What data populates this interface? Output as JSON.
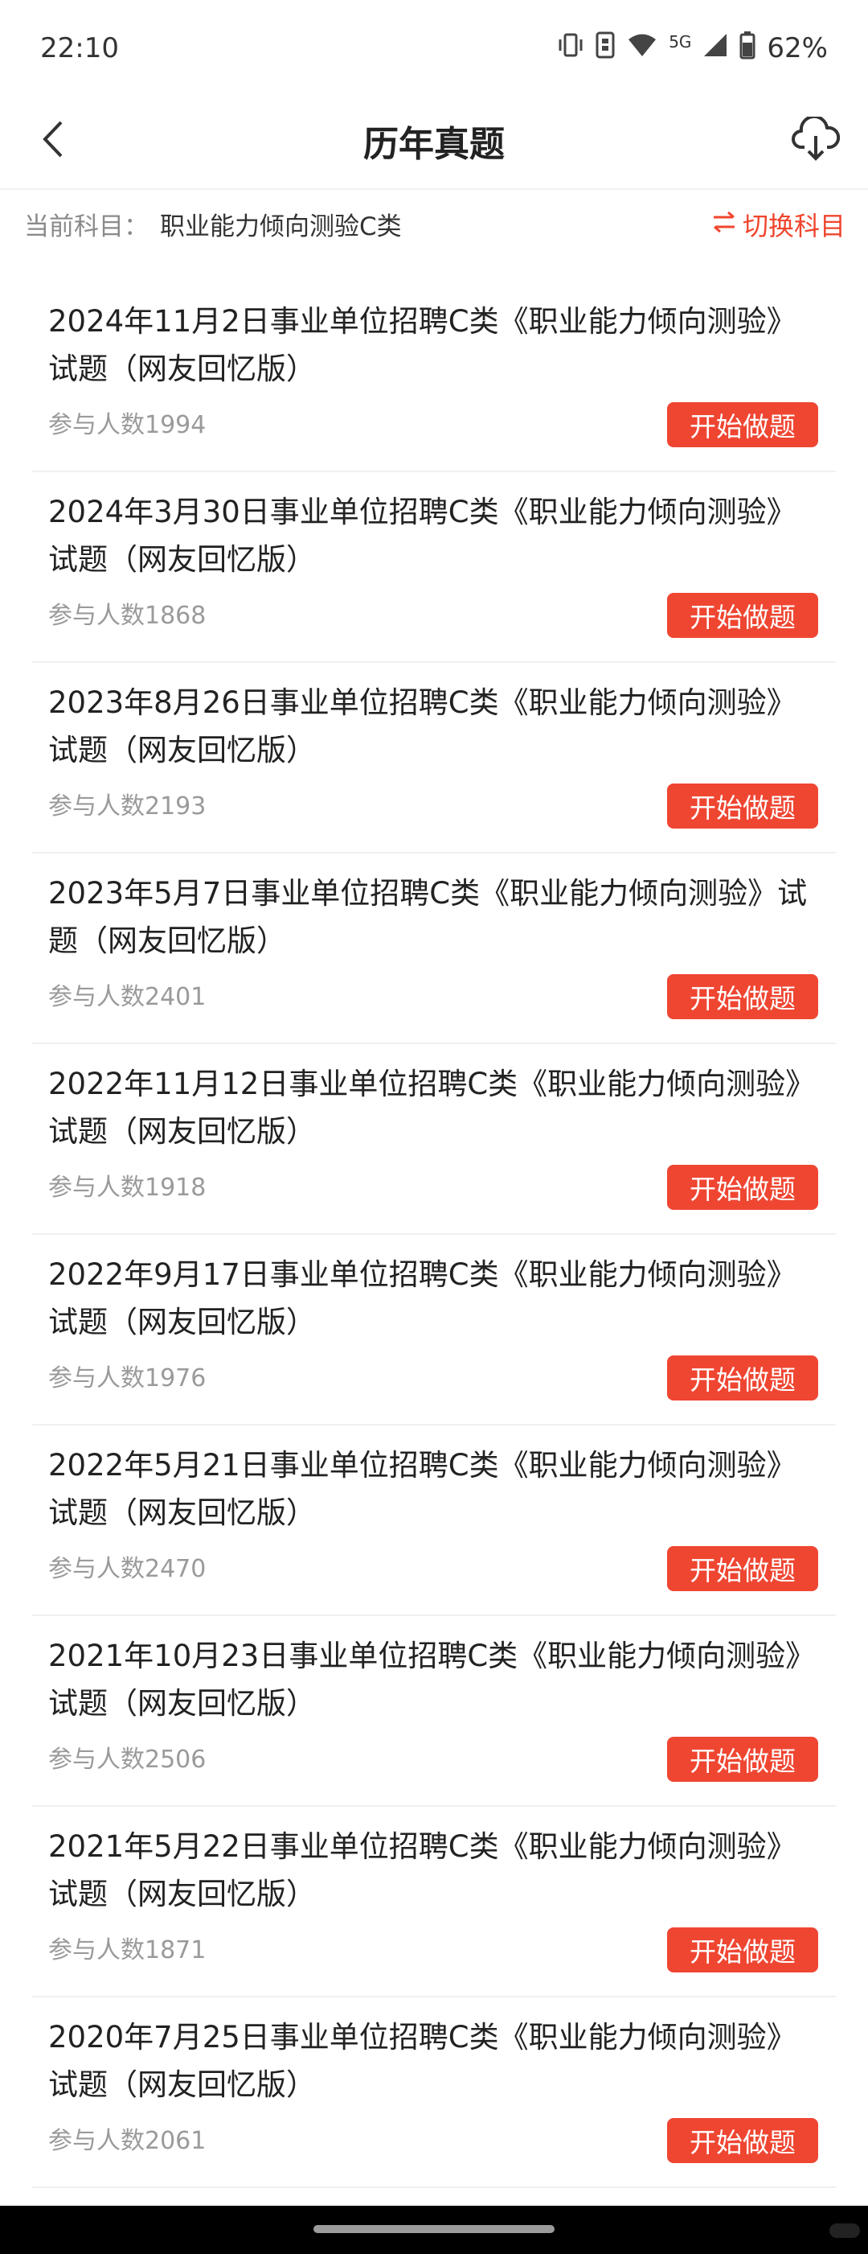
{
  "status_bar": {
    "time": "22:10",
    "network": "5G",
    "battery": "62%",
    "icons": [
      "vibrate-icon",
      "sim-icon",
      "wifi-icon",
      "signal-icon",
      "battery-icon"
    ]
  },
  "header": {
    "title": "历年真题",
    "back_icon": "chevron-left-icon",
    "download_icon": "cloud-download-icon"
  },
  "subject": {
    "label": "当前科目：",
    "value": "职业能力倾向测验C类",
    "switch_label": "切换科目",
    "switch_icon": "swap-icon"
  },
  "colors": {
    "accent": "#ef4632",
    "muted_text": "#9a9a9a"
  },
  "items": [
    {
      "title": "2024年11月2日事业单位招聘C类《职业能力倾向测验》试题（网友回忆版）",
      "participants": "参与人数1994",
      "button": "开始做题"
    },
    {
      "title": "2024年3月30日事业单位招聘C类《职业能力倾向测验》试题（网友回忆版）",
      "participants": "参与人数1868",
      "button": "开始做题"
    },
    {
      "title": "2023年8月26日事业单位招聘C类《职业能力倾向测验》试题（网友回忆版）",
      "participants": "参与人数2193",
      "button": "开始做题"
    },
    {
      "title": "2023年5月7日事业单位招聘C类《职业能力倾向测验》试题（网友回忆版）",
      "participants": "参与人数2401",
      "button": "开始做题"
    },
    {
      "title": "2022年11月12日事业单位招聘C类《职业能力倾向测验》试题（网友回忆版）",
      "participants": "参与人数1918",
      "button": "开始做题"
    },
    {
      "title": "2022年9月17日事业单位招聘C类《职业能力倾向测验》试题（网友回忆版）",
      "participants": "参与人数1976",
      "button": "开始做题"
    },
    {
      "title": "2022年5月21日事业单位招聘C类《职业能力倾向测验》试题（网友回忆版）",
      "participants": "参与人数2470",
      "button": "开始做题"
    },
    {
      "title": "2021年10月23日事业单位招聘C类《职业能力倾向测验》试题（网友回忆版）",
      "participants": "参与人数2506",
      "button": "开始做题"
    },
    {
      "title": "2021年5月22日事业单位招聘C类《职业能力倾向测验》试题（网友回忆版）",
      "participants": "参与人数1871",
      "button": "开始做题"
    },
    {
      "title": "2020年7月25日事业单位招聘C类《职业能力倾向测验》试题（网友回忆版）",
      "participants": "参与人数2061",
      "button": "开始做题"
    }
  ]
}
